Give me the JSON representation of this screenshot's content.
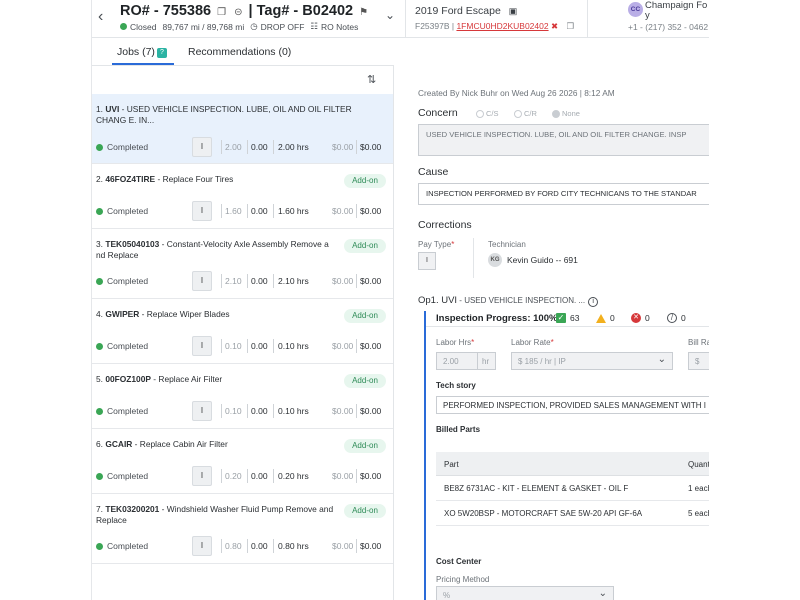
{
  "header": {
    "back_icon": "chevron-left-icon",
    "ro_label": "RO# - 755386",
    "tag_label": "| Tag# - B02402",
    "status": "Closed",
    "mileage": "89,767 mi / 89,768 mi",
    "drop_off": "DROP OFF",
    "ro_notes": "RO Notes",
    "vehicle": "2019 Ford Escape",
    "stock": "F25397B |",
    "vin": "1FMCU0HD2KUB02402",
    "customer_initials": "CC",
    "customer_name_1": "Champaign Fo",
    "customer_name_2": "y",
    "customer_phone": "+1 - (217) 352 - 0462"
  },
  "tabs": {
    "jobs": "Jobs (7)",
    "jobs_badge": "?",
    "recommendations": "Recommendations (0)"
  },
  "jobs": [
    {
      "num": "1.",
      "code": "UVI",
      "desc": " - USED VEHICLE INSPECTION. LUBE, OIL AND OIL FILTER CHANG E. IN...",
      "addon": "",
      "status": "Completed",
      "type": "I",
      "v1": "2.00",
      "v2": "0.00",
      "v3": "2.00 hrs",
      "p1": "$0.00",
      "p2": "$0.00"
    },
    {
      "num": "2.",
      "code": "46FOZ4TIRE",
      "desc": " - Replace Four Tires",
      "addon": "Add-on",
      "status": "Completed",
      "type": "I",
      "v1": "1.60",
      "v2": "0.00",
      "v3": "1.60 hrs",
      "p1": "$0.00",
      "p2": "$0.00"
    },
    {
      "num": "3.",
      "code": "TEK05040103",
      "desc": " - Constant-Velocity Axle Assembly Remove a nd Replace",
      "addon": "Add-on",
      "status": "Completed",
      "type": "I",
      "v1": "2.10",
      "v2": "0.00",
      "v3": "2.10 hrs",
      "p1": "$0.00",
      "p2": "$0.00"
    },
    {
      "num": "4.",
      "code": "GWIPER",
      "desc": " - Replace Wiper Blades",
      "addon": "Add-on",
      "status": "Completed",
      "type": "I",
      "v1": "0.10",
      "v2": "0.00",
      "v3": "0.10 hrs",
      "p1": "$0.00",
      "p2": "$0.00"
    },
    {
      "num": "5.",
      "code": "00FOZ100P",
      "desc": " - Replace Air Filter",
      "addon": "Add-on",
      "status": "Completed",
      "type": "I",
      "v1": "0.10",
      "v2": "0.00",
      "v3": "0.10 hrs",
      "p1": "$0.00",
      "p2": "$0.00"
    },
    {
      "num": "6.",
      "code": "GCAIR",
      "desc": " - Replace Cabin Air Filter",
      "addon": "Add-on",
      "status": "Completed",
      "type": "I",
      "v1": "0.20",
      "v2": "0.00",
      "v3": "0.20 hrs",
      "p1": "$0.00",
      "p2": "$0.00"
    },
    {
      "num": "7.",
      "code": "TEK03200201",
      "desc": " - Windshield Washer Fluid Pump Remove and Replace",
      "addon": "Add-on",
      "status": "Completed",
      "type": "I",
      "v1": "0.80",
      "v2": "0.00",
      "v3": "0.80 hrs",
      "p1": "$0.00",
      "p2": "$0.00"
    }
  ],
  "detail": {
    "created": "Created By Nick Buhr on Wed Aug 26 2026 | 8:12 AM",
    "concern_title": "Concern",
    "radio_cs": "C/S",
    "radio_cr": "C/R",
    "radio_none": "None",
    "concern_text": "USED VEHICLE INSPECTION. LUBE, OIL AND OIL FILTER CHANGE. INSP",
    "cause_title": "Cause",
    "cause_text": "INSPECTION PERFORMED BY FORD CITY TECHNICANS TO THE STANDAR",
    "corrections_title": "Corrections",
    "pay_type_label": "Pay Type",
    "pay_type_value": "I",
    "technician_label": "Technician",
    "tech_initials": "KG",
    "tech_name": "Kevin Guido -- 691",
    "op_code": "Op1. UVI",
    "op_desc": " - USED VEHICLE INSPECTION. ...",
    "progress_label": "Inspection Progress: 100%",
    "count_pass": "63",
    "count_warn": "0",
    "count_fail": "0",
    "count_na": "0",
    "labor_hrs_label": "Labor Hrs",
    "labor_hrs_value": "2.00",
    "labor_hrs_unit": "hr",
    "labor_rate_label": "Labor Rate",
    "labor_rate_value": "$ 185 / hr | IP",
    "bill_rate_label": "Bill Ra",
    "bill_rate_value": "$",
    "tech_story_label": "Tech story",
    "tech_story_text": "PERFORMED INSPECTION, PROVIDED SALES MANAGEMENT WITH I",
    "billed_parts_label": "Billed Parts",
    "col_part": "Part",
    "col_qty": "Quant",
    "parts": [
      {
        "part": "BE8Z 6731AC - KIT - ELEMENT & GASKET - OIL F",
        "qty": "1 each"
      },
      {
        "part": "XO 5W20BSP - MOTORCRAFT SAE 5W-20 API GF-6A",
        "qty": "5 each"
      }
    ],
    "cost_center_label": "Cost Center",
    "pricing_method_label": "Pricing Method",
    "pricing_method_value": "%"
  }
}
